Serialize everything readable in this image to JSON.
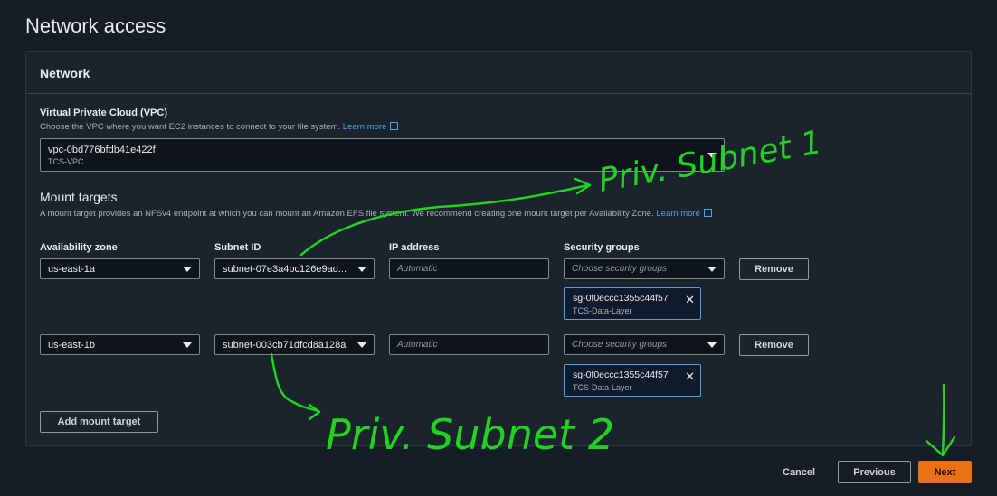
{
  "page": {
    "title": "Network access"
  },
  "panel": {
    "title": "Network"
  },
  "vpc": {
    "label": "Virtual Private Cloud (VPC)",
    "description": "Choose the VPC where you want EC2 instances to connect to your file system.",
    "learn_more": "Learn more",
    "selected_id": "vpc-0bd776bfdb41e422f",
    "selected_name": "TCS-VPC"
  },
  "mount_targets": {
    "title": "Mount targets",
    "description": "A mount target provides an NFSv4 endpoint at which you can mount an Amazon EFS file system. We recommend creating one mount target per Availability Zone.",
    "learn_more": "Learn more",
    "columns": [
      "Availability zone",
      "Subnet ID",
      "IP address",
      "Security groups"
    ],
    "ip_placeholder": "Automatic",
    "sg_placeholder": "Choose security groups",
    "remove_label": "Remove",
    "rows": [
      {
        "az": "us-east-1a",
        "subnet": "subnet-07e3a4bc126e9ad...",
        "sg_id": "sg-0f0eccc1355c44f57",
        "sg_name": "TCS-Data-Layer"
      },
      {
        "az": "us-east-1b",
        "subnet": "subnet-003cb71dfcd8a128a",
        "sg_id": "sg-0f0eccc1355c44f57",
        "sg_name": "TCS-Data-Layer"
      }
    ],
    "add_label": "Add mount target"
  },
  "footer": {
    "cancel": "Cancel",
    "previous": "Previous",
    "next": "Next"
  },
  "annotations": {
    "color": "#1fd31f",
    "text1": "Priv. Subnet 1",
    "text2": "Priv. Subnet 2"
  }
}
